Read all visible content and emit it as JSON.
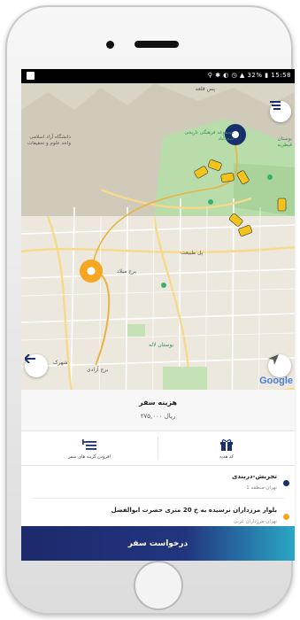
{
  "status_bar": {
    "right_text": "⚲ ✱ ◐ ◷ ▲ 32% ▮ 15:58"
  },
  "map": {
    "labels": {
      "top": "پس قلعه",
      "complex": "مجموعه فرهنگی تاریخی سعدآباد",
      "university": "دانشگاه آزاد اسلامی واحد علوم و تحقیقات",
      "park": "بوستان قیطریه",
      "tower": "برج میلاد",
      "bridge": "پل طبیعت",
      "park2": "بوستان لاله",
      "city": "شهرک",
      "tower2": "برج آزادی"
    },
    "google_logo": "Google"
  },
  "fare": {
    "title": "هزینه سفر",
    "price": "۲۷۵,۰۰۰ ریال"
  },
  "actions": [
    {
      "label": "کد هدیه"
    },
    {
      "label": "افزودن گزینه های سفر"
    }
  ],
  "destination": {
    "name": "تجریش-دربندی",
    "sub": "تهران-منطقه 1",
    "color": "#1a2f6d"
  },
  "origin": {
    "name": "بلوار مرزداران نرسیده به خ 20 متری حضرت ابوالفضل",
    "sub": "تهران-مرزداران غربی",
    "color": "#f5a623"
  },
  "request_button": "درخواست سفر",
  "colors": {
    "accent": "#22357f",
    "pin_orange": "#f5a623",
    "pin_navy": "#1a2f6d"
  }
}
